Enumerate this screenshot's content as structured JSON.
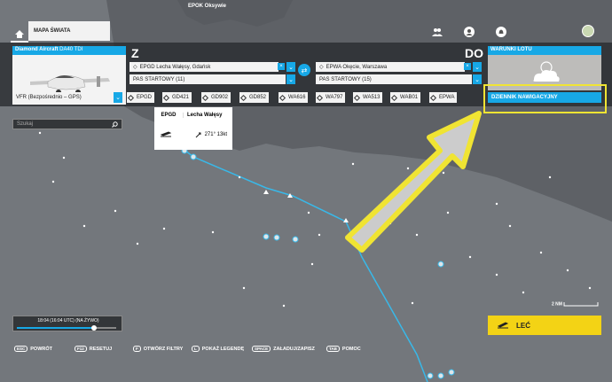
{
  "map": {
    "top_label": "EPOK  Oksywie",
    "scale_label": "2 NM"
  },
  "header": {
    "tab_label": "MAPA ŚWIATA"
  },
  "aircraft": {
    "name": "Diamond Aircraft",
    "model": "DA40 TDI"
  },
  "departure": {
    "letter": "Z",
    "airport": "EPGD Lecha Wałęsy, Gdańsk",
    "runway": "PAS STARTOWY (11)"
  },
  "arrival": {
    "letter": "DO",
    "airport": "EPWA Okęcie, Warszawa",
    "runway": "PAS STARTOWY (15)"
  },
  "weather": {
    "title": "WARUNKI LOTU"
  },
  "logbook": {
    "label": "DZIENNIK NAWIGACYJNY"
  },
  "flight_type": {
    "value": "VFR (Bezpośrednio – GPS)"
  },
  "waypoints": [
    "EPGD",
    "GD421",
    "GD902",
    "GD852",
    "WA616",
    "WA797",
    "WA513",
    "WAB01",
    "EPWA"
  ],
  "search": {
    "placeholder": "Szukaj"
  },
  "popup": {
    "code": "EPGD",
    "name": "Lecha Wałęsy",
    "wind": "271° 13kt"
  },
  "timeline": {
    "label": "18:04 (16:04 UTC) (NA ŻYWO)",
    "progress": 0.78
  },
  "fly_button": {
    "label": "LEĆ"
  },
  "footer": [
    {
      "key": "ESC",
      "label": "POWRÓT"
    },
    {
      "key": "F12",
      "label": "RESETUJ"
    },
    {
      "key": "F",
      "label": "OTWÓRZ FILTRY"
    },
    {
      "key": "L",
      "label": "POKAŻ LEGENDĘ"
    },
    {
      "key": "SPACE",
      "label": "ZAŁADUJ/ZAPISZ"
    },
    {
      "key": "TAB",
      "label": "POMOC"
    }
  ],
  "colors": {
    "accent": "#17a8e6",
    "highlight": "#f0e433",
    "fly": "#f3d315"
  }
}
